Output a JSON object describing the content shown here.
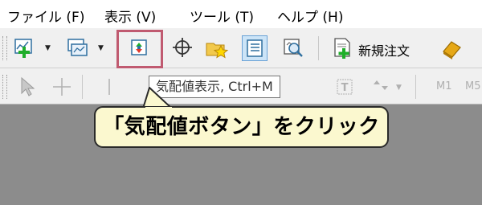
{
  "menu": {
    "file": "ファイル (F)",
    "view": "表示 (V)",
    "tools": "ツール (T)",
    "help": "ヘルプ (H)"
  },
  "toolbar": {
    "new_order_label": "新規注文",
    "tooltip": "気配値表示, Ctrl+M",
    "timeframe_m1": "M1",
    "timeframe_m5": "M5"
  },
  "callout": {
    "text": "「気配値ボタン」をクリック"
  },
  "colors": {
    "highlight_border": "#c05a70",
    "callout_bg": "#fbf8cf",
    "workspace_bg": "#8c8c8c"
  },
  "icons": [
    "new-chart-icon",
    "profiles-icon",
    "market-watch-icon",
    "crosshair-icon",
    "favorites-star-icon",
    "navigator-icon",
    "search-zoom-icon",
    "new-order-icon",
    "expert-advisor-icon",
    "cursor-icon",
    "crosshair-line-icon",
    "vertical-line-icon",
    "text-tool-icon",
    "arrows-icon"
  ]
}
